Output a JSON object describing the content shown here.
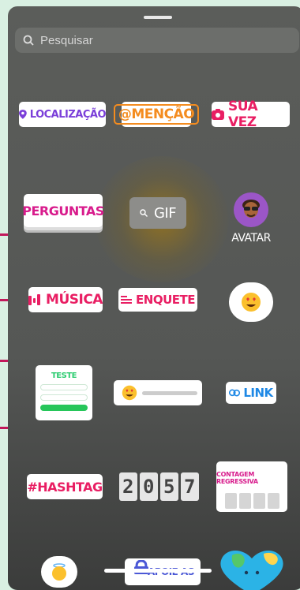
{
  "search": {
    "placeholder": "Pesquisar"
  },
  "stickers": {
    "localizacao": "LOCALIZAÇÃO",
    "mencao": "@MENÇÃO",
    "sua_vez": "SUA VEZ",
    "perguntas": "PERGUNTAS",
    "gif": "GIF",
    "avatar": "AVATAR",
    "musica": "MÚSICA",
    "enquete": "ENQUETE",
    "teste": "TESTE",
    "link": "LINK",
    "hashtag": "#HASHTAG",
    "digits": [
      "2",
      "0",
      "5",
      "7"
    ],
    "contagem": "CONTAGEM REGRESSIVA",
    "apoie": "APOIE AS"
  },
  "icons": [
    "search-icon",
    "location-pin-icon",
    "camera-icon",
    "search-icon",
    "music-bars-icon",
    "list-icon",
    "heart-eyes-emoji-icon",
    "link-icon",
    "angel-emoji-icon",
    "heart-globe-icon"
  ],
  "colors": {
    "accent_pink": "#e91e63",
    "purple": "#7b3fd9",
    "orange": "#f48c1f",
    "link_blue": "#1e88e5",
    "green": "#26c65a",
    "bracket": "#c2185b"
  }
}
